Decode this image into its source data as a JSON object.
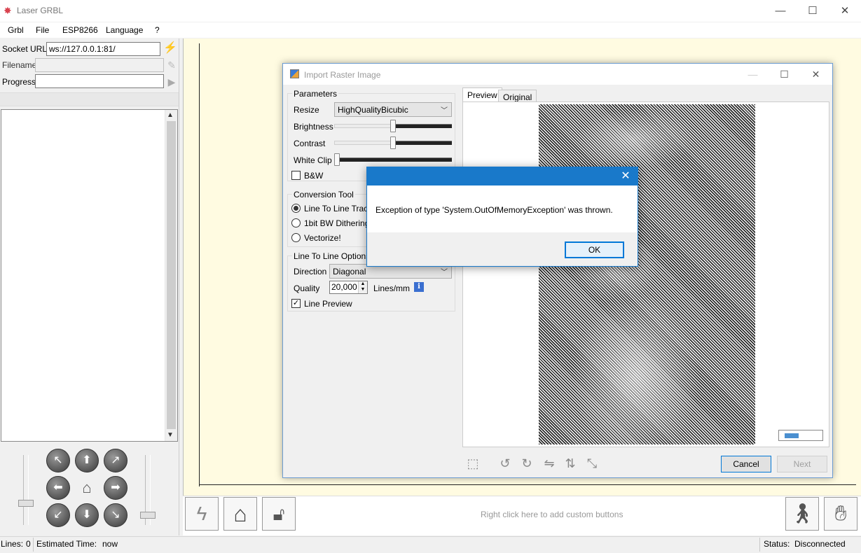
{
  "app": {
    "title": "Laser GRBL",
    "menu": [
      "Grbl",
      "File",
      "ESP8266",
      "Language",
      "?"
    ]
  },
  "window_controls": {
    "minimize": "—",
    "maximize": "☐",
    "close": "✕"
  },
  "left": {
    "socket_label": "Socket URL",
    "socket_value": "ws://127.0.0.1:81/",
    "filename_label": "Filename",
    "filename_value": "",
    "progress_label": "Progress",
    "progress_value": ""
  },
  "jog_icons": [
    "arrow-up-left-icon",
    "arrow-up-icon",
    "arrow-up-right-icon",
    "arrow-left-icon",
    "home-icon",
    "arrow-right-icon",
    "arrow-down-left-icon",
    "arrow-down-icon",
    "arrow-down-right-icon"
  ],
  "bottom_toolbar": {
    "hint": "Right click here to add custom buttons"
  },
  "status": {
    "lines_label": "Lines:",
    "lines_value": "0",
    "est_label": "Estimated Time:",
    "est_value": "now",
    "status_label": "Status:",
    "status_value": "Disconnected"
  },
  "import_dialog": {
    "title": "Import Raster Image",
    "params_group": "Parameters",
    "resize_label": "Resize",
    "resize_value": "HighQualityBicubic",
    "brightness_label": "Brightness",
    "contrast_label": "Contrast",
    "whiteclip_label": "White Clip",
    "sliders": {
      "brightness": 0.53,
      "contrast": 0.53,
      "whiteclip": 0.02
    },
    "bw_label": "B&W",
    "bw_checked": false,
    "conv_group": "Conversion Tool",
    "conv_options": [
      "Line To Line Tracing",
      "1bit BW Dithering",
      "Vectorize!"
    ],
    "conv_selected": 0,
    "l2l_group": "Line To Line Options",
    "direction_label": "Direction",
    "direction_value": "Diagonal",
    "quality_label": "Quality",
    "quality_value": "20,000",
    "quality_unit": "Lines/mm",
    "line_preview_label": "Line Preview",
    "line_preview_checked": true,
    "tabs": [
      "Preview",
      "Original"
    ],
    "active_tab": "Preview",
    "cancel_label": "Cancel",
    "next_label": "Next"
  },
  "error_dialog": {
    "message": "Exception of type 'System.OutOfMemoryException' was thrown.",
    "ok_label": "OK"
  }
}
